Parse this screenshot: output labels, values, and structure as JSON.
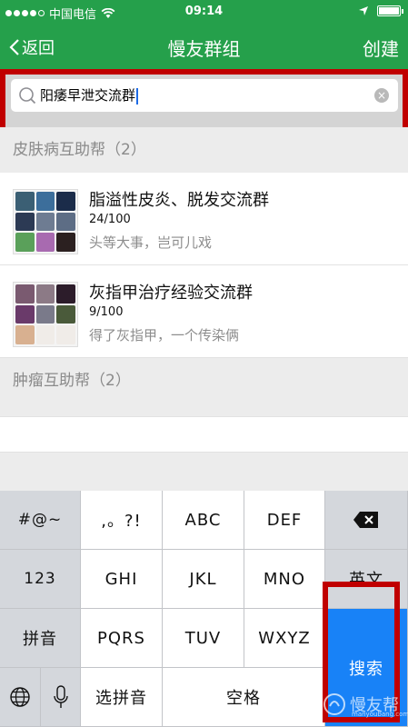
{
  "status_bar": {
    "carrier": "中国电信",
    "time": "09:14",
    "signal_filled": 4,
    "signal_total": 5,
    "battery_level": 1.0
  },
  "nav": {
    "back_label": "返回",
    "title": "慢友群组",
    "create_label": "创建"
  },
  "search": {
    "query": "阳痿早泄交流群"
  },
  "sections": [
    {
      "header": "皮肤病互助帮（2）",
      "groups": [
        {
          "name": "脂溢性皮炎、脱发交流群",
          "count": "24/100",
          "desc": "头等大事，岂可儿戏"
        },
        {
          "name": "灰指甲治疗经验交流群",
          "count": "9/100",
          "desc": "得了灰指甲，一个传染俩"
        }
      ]
    },
    {
      "header": "肿瘤互助帮（2）"
    }
  ],
  "keyboard": {
    "row1": [
      "#@~",
      ",。?!",
      "ABC",
      "DEF"
    ],
    "row2": [
      "123",
      "GHI",
      "JKL",
      "MNO",
      "英文"
    ],
    "row3": [
      "拼音",
      "PQRS",
      "TUV",
      "WXYZ"
    ],
    "row4": [
      "选拼音",
      "空格"
    ],
    "search_label": "搜索",
    "backspace_icon": "backspace-icon",
    "globe_icon": "globe-icon",
    "mic_icon": "microphone-icon"
  },
  "watermark": {
    "text": "慢友帮",
    "sub": "manyoubang.com"
  },
  "colors": {
    "brand_green": "#25a04b",
    "search_blue": "#1882f7",
    "highlight_red": "#c00000"
  }
}
